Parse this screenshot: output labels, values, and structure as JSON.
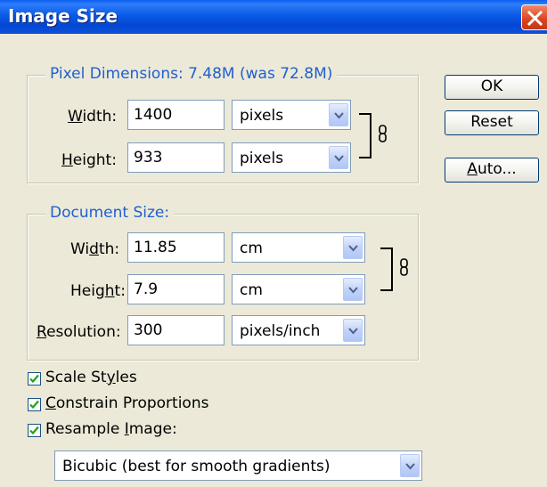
{
  "window": {
    "title": "Image Size"
  },
  "pixel_dimensions": {
    "legend": "Pixel Dimensions:  7.48M (was 72.8M)",
    "width_label": "Width:",
    "width_value": "1400",
    "width_unit": "pixels",
    "height_label": "Height:",
    "height_value": "933",
    "height_unit": "pixels"
  },
  "document_size": {
    "legend": "Document Size:",
    "width_label": "Width:",
    "width_value": "11.85",
    "width_unit": "cm",
    "height_label": "Height:",
    "height_value": "7.9",
    "height_unit": "cm",
    "resolution_label": "Resolution:",
    "resolution_value": "300",
    "resolution_unit": "pixels/inch"
  },
  "buttons": {
    "ok": "OK",
    "reset": "Reset",
    "auto": "Auto..."
  },
  "options": {
    "scale_styles": {
      "label": "Scale Styles",
      "checked": true
    },
    "constrain": {
      "label": "Constrain Proportions",
      "checked": true
    },
    "resample": {
      "label": "Resample Image:",
      "checked": true
    },
    "resample_method": "Bicubic (best for smooth gradients)"
  },
  "colors": {
    "title_bar": "#0a5ae6",
    "legend_text": "#1f5fd0",
    "dialog_bg": "#ece9d8",
    "close_button": "#d9431f"
  },
  "icons": [
    "close-icon",
    "link-icon",
    "chevron-down-icon",
    "checkmark-icon"
  ]
}
